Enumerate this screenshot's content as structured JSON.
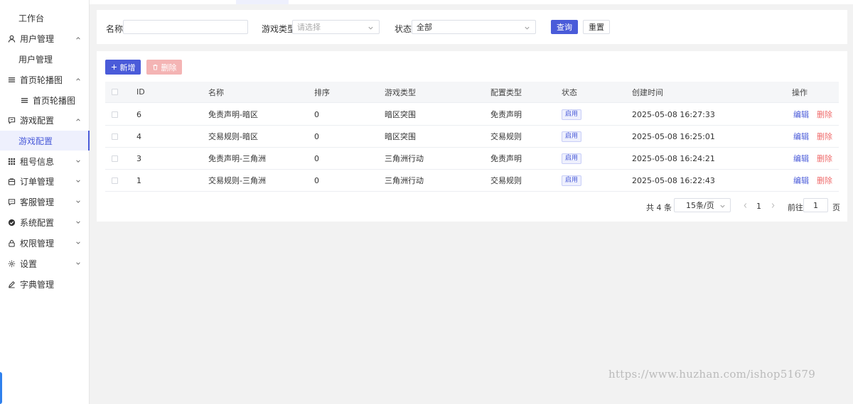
{
  "sidebar": {
    "items": [
      {
        "label": "工作台",
        "icon": "none"
      },
      {
        "label": "用户管理",
        "icon": "user-icon",
        "arrow": "up"
      },
      {
        "label": "用户管理",
        "icon": "none"
      },
      {
        "label": "首页轮播图",
        "icon": "menu-lines-icon",
        "arrow": "up"
      },
      {
        "label": "首页轮播图",
        "icon": "menu-lines-icon"
      },
      {
        "label": "游戏配置",
        "icon": "message-icon",
        "arrow": "up"
      },
      {
        "label": "游戏配置",
        "icon": "none",
        "active": true
      },
      {
        "label": "租号信息",
        "icon": "grid-icon",
        "arrow": "down"
      },
      {
        "label": "订单管理",
        "icon": "cart-icon",
        "arrow": "down"
      },
      {
        "label": "客服管理",
        "icon": "chat-icon",
        "arrow": "down"
      },
      {
        "label": "系统配置",
        "icon": "check-circle-icon",
        "arrow": "down"
      },
      {
        "label": "权限管理",
        "icon": "lock-icon",
        "arrow": "down"
      },
      {
        "label": "设置",
        "icon": "gear-icon",
        "arrow": "down"
      },
      {
        "label": "字典管理",
        "icon": "pen-icon"
      }
    ]
  },
  "search": {
    "name_label": "名称",
    "name_value": "",
    "type_label": "游戏类型",
    "type_placeholder": "请选择",
    "status_label": "状态",
    "status_value": "全部",
    "query_button": "查询",
    "reset_button": "重置"
  },
  "toolbar": {
    "add_button": "新增",
    "delete_button": "删除"
  },
  "table": {
    "columns": [
      "ID",
      "名称",
      "排序",
      "游戏类型",
      "配置类型",
      "状态",
      "创建时间",
      "操作"
    ],
    "rows": [
      {
        "id": "6",
        "name": "免责声明-暗区",
        "sort": "0",
        "game_type": "暗区突围",
        "config_type": "免责声明",
        "status": "启用",
        "created": "2025-05-08 16:27:33",
        "edit": "编辑",
        "delete": "删除"
      },
      {
        "id": "4",
        "name": "交易规则-暗区",
        "sort": "0",
        "game_type": "暗区突围",
        "config_type": "交易规则",
        "status": "启用",
        "created": "2025-05-08 16:25:01",
        "edit": "编辑",
        "delete": "删除"
      },
      {
        "id": "3",
        "name": "免责声明-三角洲",
        "sort": "0",
        "game_type": "三角洲行动",
        "config_type": "免责声明",
        "status": "启用",
        "created": "2025-05-08 16:24:21",
        "edit": "编辑",
        "delete": "删除"
      },
      {
        "id": "1",
        "name": "交易规则-三角洲",
        "sort": "0",
        "game_type": "三角洲行动",
        "config_type": "交易规则",
        "status": "启用",
        "created": "2025-05-08 16:22:43",
        "edit": "编辑",
        "delete": "删除"
      }
    ]
  },
  "pagination": {
    "total": "共 4 条",
    "page_size": "15条/页",
    "current_page": "1",
    "goto_label": "前往",
    "goto_value": "1",
    "page_suffix": "页"
  },
  "watermark": "https://www.huzhan.com/ishop51679",
  "colors": {
    "primary": "#4a5bd9",
    "danger": "#ef6b6b",
    "danger_disabled": "#f4b4b4"
  }
}
